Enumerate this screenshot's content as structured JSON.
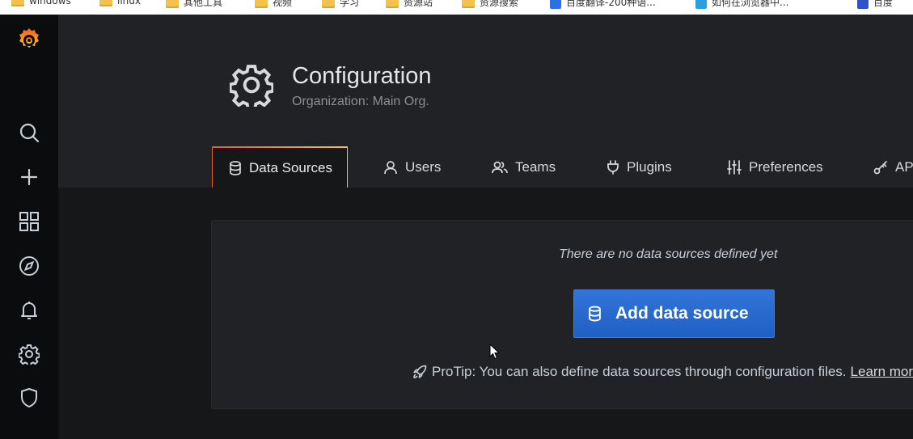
{
  "bookmarks": [
    {
      "label": "windows",
      "type": "folder"
    },
    {
      "label": "linux",
      "type": "folder"
    },
    {
      "label": "其他工具",
      "type": "folder"
    },
    {
      "label": "视频",
      "type": "folder"
    },
    {
      "label": "学习",
      "type": "folder"
    },
    {
      "label": "资源站",
      "type": "folder"
    },
    {
      "label": "资源搜索",
      "type": "folder"
    },
    {
      "label": "百度翻译-200种语...",
      "type": "link",
      "color": "#2f6fe4"
    },
    {
      "label": "如何在浏览器中...",
      "type": "link",
      "color": "#2aa0e0"
    },
    {
      "label": "百度",
      "type": "link",
      "color": "#3052c8"
    }
  ],
  "sidebar": {
    "logo": "grafana-logo",
    "items": [
      {
        "name": "search",
        "icon": "search-icon"
      },
      {
        "name": "create",
        "icon": "plus-icon"
      },
      {
        "name": "dashboards",
        "icon": "apps-icon"
      },
      {
        "name": "explore",
        "icon": "compass-icon"
      },
      {
        "name": "alerting",
        "icon": "bell-icon"
      },
      {
        "name": "configuration",
        "icon": "gear-icon"
      },
      {
        "name": "server-admin",
        "icon": "shield-icon"
      }
    ]
  },
  "page": {
    "title": "Configuration",
    "subtitle": "Organization: Main Org."
  },
  "tabs": [
    {
      "label": "Data Sources",
      "icon": "database-icon",
      "active": true
    },
    {
      "label": "Users",
      "icon": "user-icon",
      "active": false
    },
    {
      "label": "Teams",
      "icon": "users-icon",
      "active": false
    },
    {
      "label": "Plugins",
      "icon": "plug-icon",
      "active": false
    },
    {
      "label": "Preferences",
      "icon": "sliders-icon",
      "active": false
    },
    {
      "label": "API Keys",
      "icon": "key-icon",
      "active": false
    }
  ],
  "empty_state": {
    "message": "There are no data sources defined yet",
    "button_label": "Add data source",
    "protip_text": "ProTip: You can also define data sources through configuration files.",
    "protip_link": "Learn more"
  },
  "colors": {
    "accent_blue": "#3274d9",
    "tab_gradient_start": "#f05a28",
    "tab_gradient_end": "#fbca0a",
    "logo_orange": "#f46800"
  }
}
